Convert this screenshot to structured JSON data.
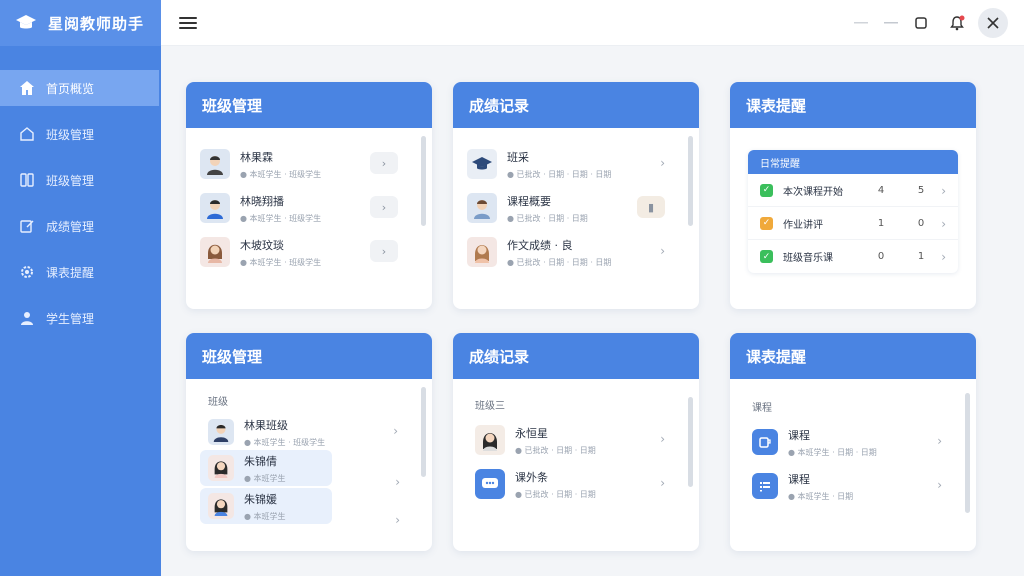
{
  "app": {
    "title": "星阅教师助手"
  },
  "sidebar": {
    "items": [
      {
        "label": "首页概览",
        "icon": "home-icon",
        "active": true
      },
      {
        "label": "班级管理",
        "icon": "home-outline-icon",
        "active": false
      },
      {
        "label": "班级管理",
        "icon": "book-icon",
        "active": false
      },
      {
        "label": "成绩管理",
        "icon": "edit-icon",
        "active": false
      },
      {
        "label": "课表提醒",
        "icon": "gear-icon",
        "active": false
      },
      {
        "label": "学生管理",
        "icon": "user-icon",
        "active": false
      }
    ]
  },
  "cards": {
    "c1": {
      "title": "班级管理",
      "rows": [
        {
          "name": "林果霖",
          "meta": "● 本班学生 · 班级学生"
        },
        {
          "name": "林晓翔播",
          "meta": "● 本班学生 · 班级学生"
        },
        {
          "name": "木坡玟琰",
          "meta": "● 本班学生 · 班级学生"
        }
      ]
    },
    "c2": {
      "title": "成绩记录",
      "rows": [
        {
          "name": "班采",
          "meta": "● 已批改 · 日期 · 日期 · 日期"
        },
        {
          "name": "课程概要",
          "meta": "● 已批改 · 日期 · 日期"
        },
        {
          "name": "作文成绩 · 良",
          "meta": "● 已批改 · 日期 · 日期 · 日期"
        }
      ]
    },
    "c3": {
      "title": "课表提醒",
      "header": "日常提醒",
      "rows": [
        {
          "name": "本次课程开始",
          "a": "4",
          "b": "5",
          "color": "#3bbf5c"
        },
        {
          "name": "作业讲评",
          "a": "1",
          "b": "0",
          "color": "#f0a93b"
        },
        {
          "name": "班级音乐课",
          "a": "0",
          "b": "1",
          "color": "#3bbf5c"
        }
      ]
    },
    "c4": {
      "title": "班级管理",
      "section": "班级",
      "rows": [
        {
          "name": "林果班级",
          "meta": "● 本班学生 · 班级学生"
        },
        {
          "name": "朱锦倩",
          "meta": "● 本班学生"
        },
        {
          "name": "朱锦媛",
          "meta": "● 本班学生"
        }
      ]
    },
    "c5": {
      "title": "成绩记录",
      "section": "班级三",
      "rows": [
        {
          "name": "永恒星",
          "meta": "● 已批改 · 日期 · 日期"
        },
        {
          "name": "课外条",
          "meta": "● 已批改 · 日期 · 日期"
        }
      ]
    },
    "c6": {
      "title": "课表提醒",
      "section": "课程",
      "rows": [
        {
          "name": "课程",
          "meta": "● 本班学生 · 日期 · 日期"
        },
        {
          "name": "课程",
          "meta": "● 本班学生 · 日期"
        }
      ]
    }
  },
  "colors": {
    "primary": "#4a84e2",
    "active_nav": "#78a6f0",
    "background": "#f3f5f8"
  }
}
